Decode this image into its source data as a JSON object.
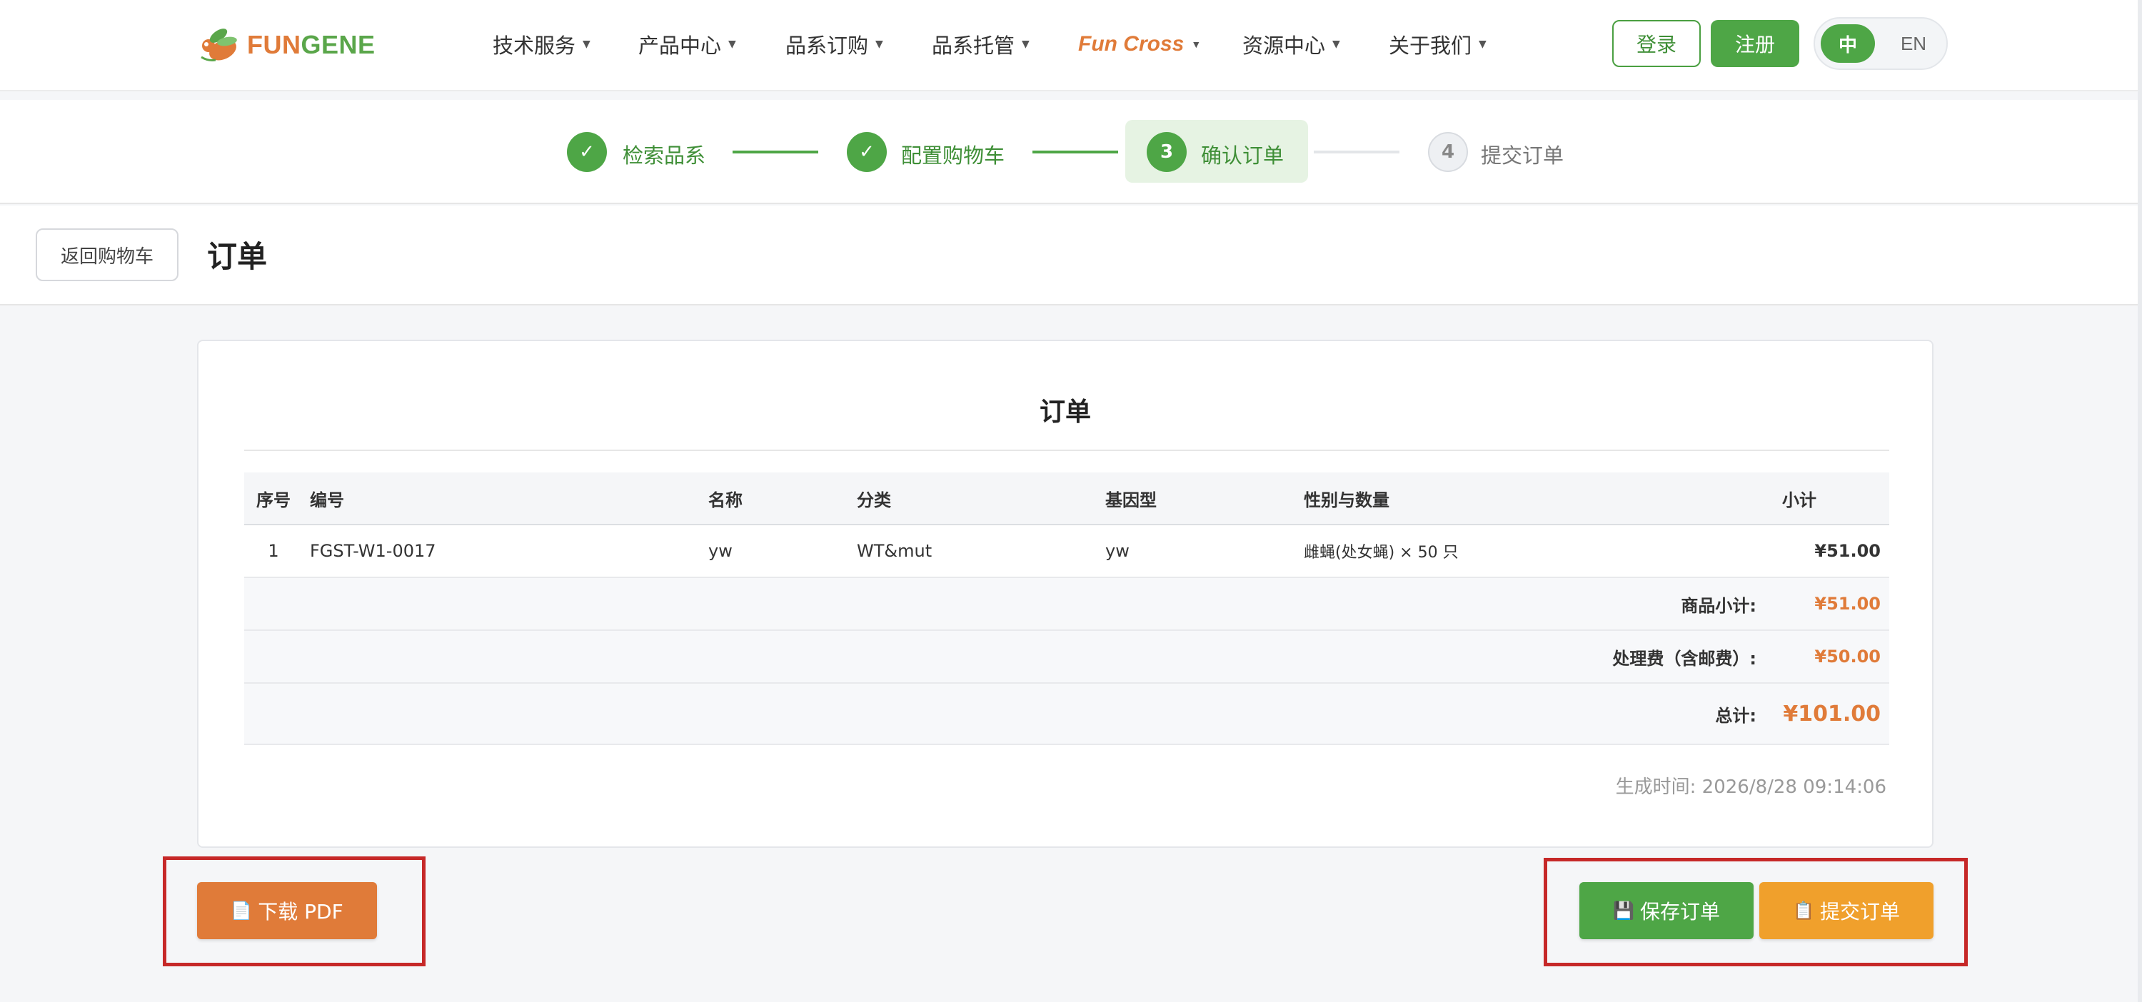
{
  "brand": {
    "logo_text_orange": "FUN",
    "logo_text_green": "GENE",
    "orange": "#e07b39",
    "green": "#4ea646"
  },
  "nav": {
    "items": [
      {
        "label": "技术服务"
      },
      {
        "label": "产品中心"
      },
      {
        "label": "品系订购"
      },
      {
        "label": "品系托管"
      },
      {
        "label": "Fun Cross"
      },
      {
        "label": "资源中心"
      },
      {
        "label": "关于我们"
      }
    ],
    "login_label": "登录",
    "register_label": "注册",
    "lang_zh": "中",
    "lang_en": "EN"
  },
  "steps": [
    {
      "label": "检索品系",
      "mark": "✓",
      "state": "done"
    },
    {
      "label": "配置购物车",
      "mark": "✓",
      "state": "done"
    },
    {
      "label": "确认订单",
      "mark": "3",
      "state": "active"
    },
    {
      "label": "提交订单",
      "mark": "4",
      "state": "todo"
    }
  ],
  "title_row": {
    "back_label": "返回购物车",
    "title": "订单"
  },
  "order": {
    "title": "订单",
    "columns": [
      "序号",
      "编号",
      "名称",
      "分类",
      "基因型",
      "性别与数量",
      "小计"
    ],
    "rows": [
      {
        "index": "1",
        "code": "FGST-W1-0017",
        "name": "yw",
        "category": "WT&mut",
        "genotype": "yw",
        "sex_qty": "雌蝇(处女蝇) × 50 只",
        "subtotal": "¥51.00"
      }
    ],
    "goods_subtotal_label": "商品小计:",
    "goods_subtotal": "¥51.00",
    "fee_label": "处理费（含邮费）:",
    "fee": "¥50.00",
    "total_label": "总计:",
    "total": "¥101.00",
    "generated_at": "生成时间: 2026/8/28 09:14:06"
  },
  "actions": {
    "pdf_label": "下载 PDF",
    "pdf_icon": "📄",
    "save_label": "保存订单",
    "save_icon": "💾",
    "submit_label": "提交订单",
    "submit_icon": "📋",
    "highlight_color": "#c62828"
  }
}
